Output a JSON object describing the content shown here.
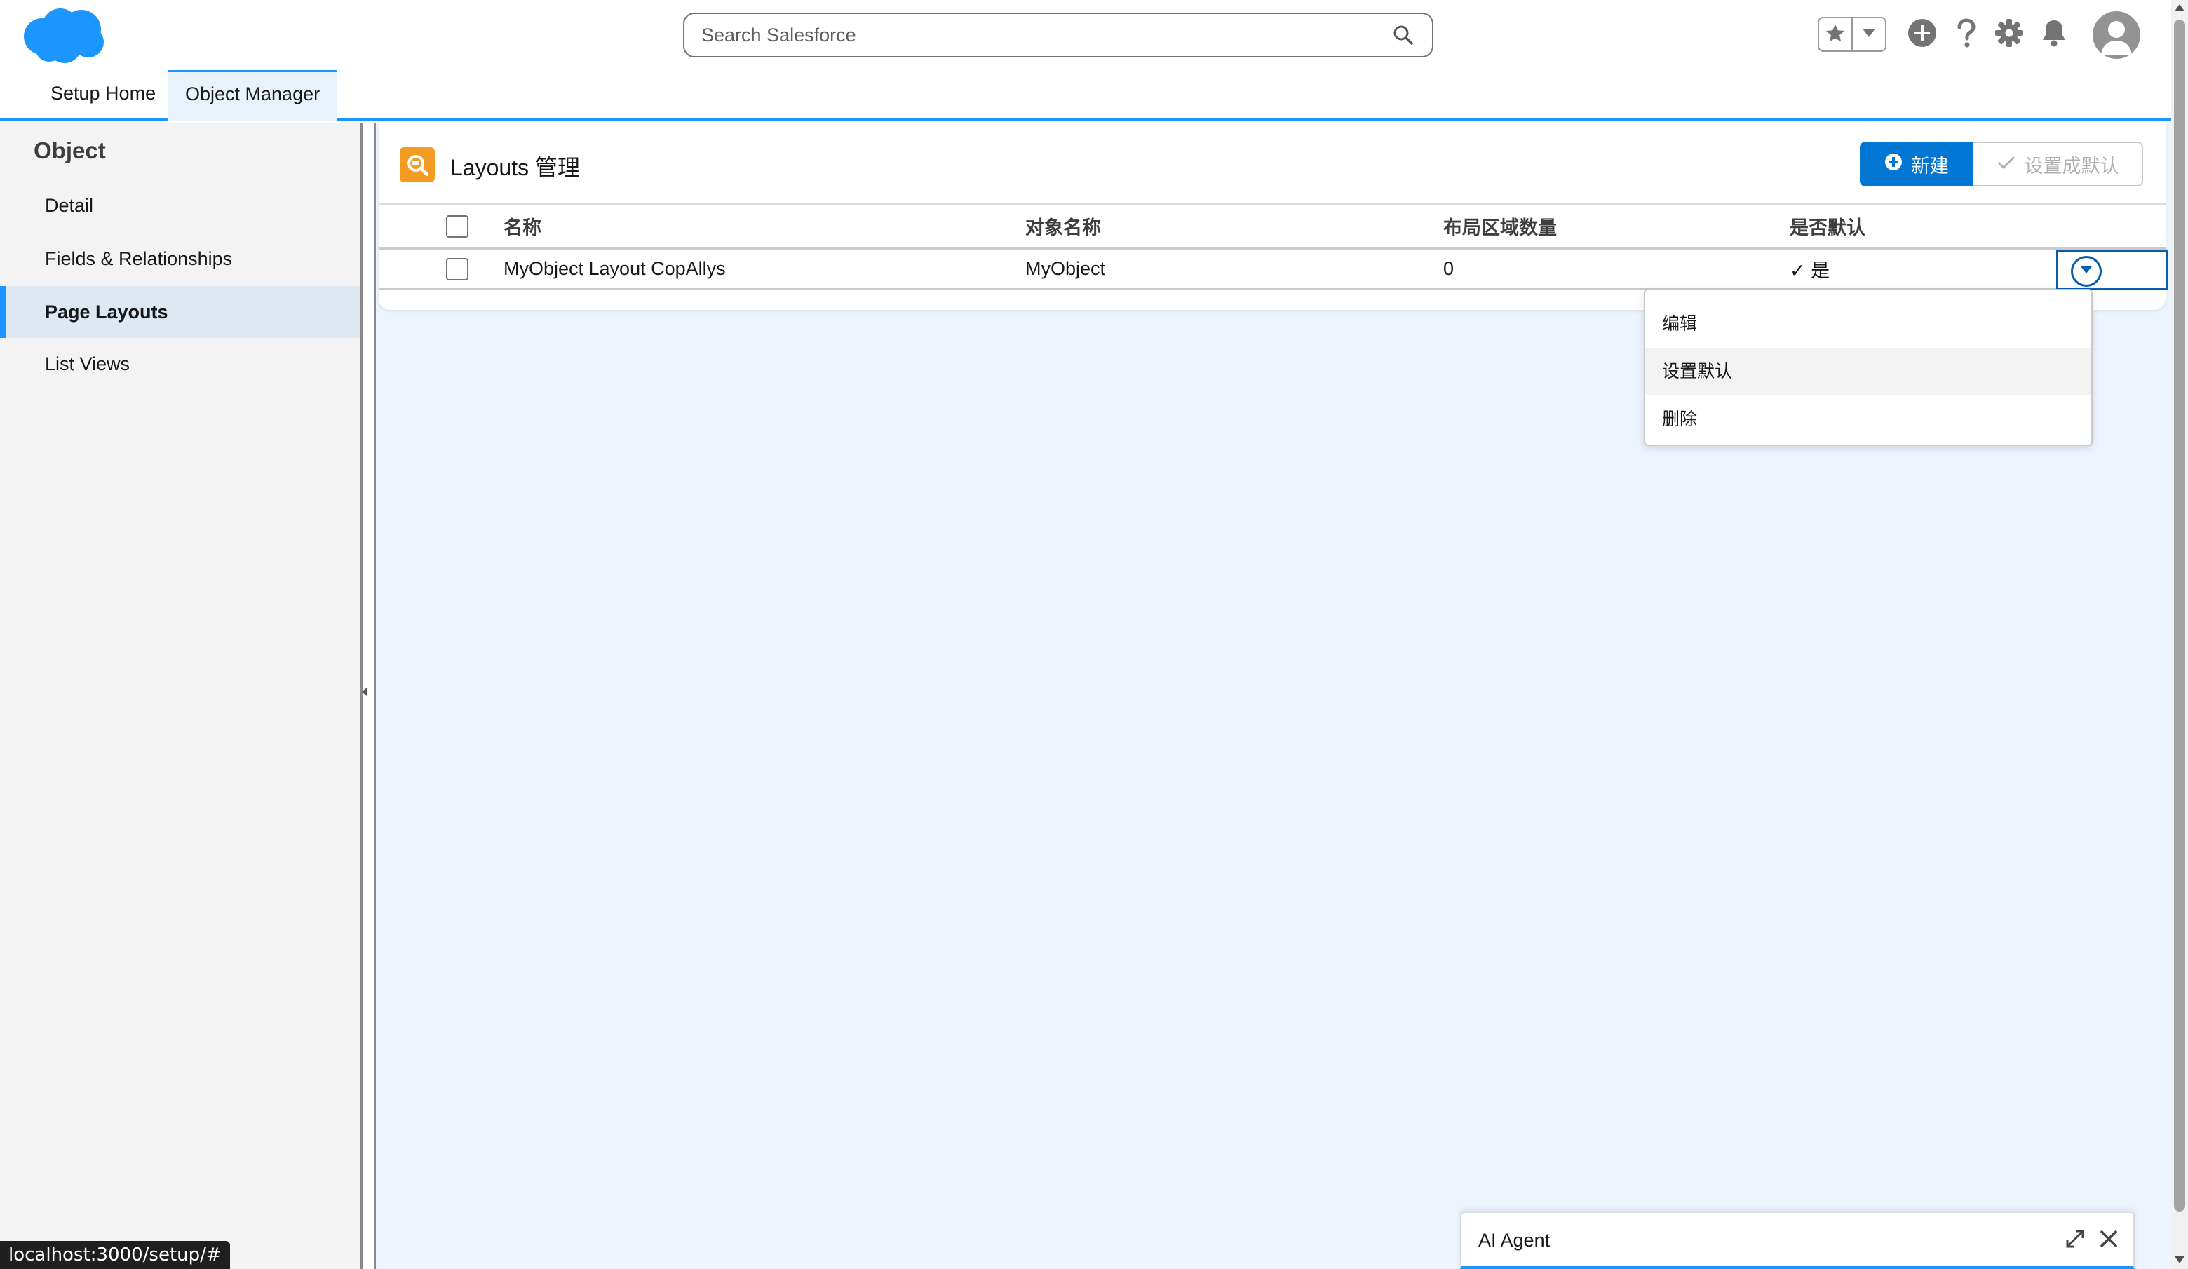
{
  "header": {
    "search_placeholder": "Search Salesforce",
    "brand_color": "#1b96ff",
    "icons": [
      "salesforce-cloud-logo",
      "search-icon",
      "star-icon",
      "chevron-down-icon",
      "plus-circle-icon",
      "help-icon",
      "gear-icon",
      "bell-icon",
      "user-avatar-icon"
    ]
  },
  "tabs": [
    {
      "label": "Setup Home"
    },
    {
      "label": "Object Manager"
    }
  ],
  "sidebar": {
    "title": "Object",
    "items": [
      {
        "label": "Detail"
      },
      {
        "label": "Fields & Relationships"
      },
      {
        "label": "Page Layouts"
      },
      {
        "label": "List Views"
      }
    ]
  },
  "card": {
    "title": "Layouts 管理",
    "new_button": "新建",
    "set_default_button": "设置成默认",
    "columns": [
      "名称",
      "对象名称",
      "布局区域数量",
      "是否默认"
    ],
    "rows": [
      {
        "name": "MyObject Layout CopAllys",
        "object": "MyObject",
        "sections": "0",
        "is_default": "✓ 是"
      }
    ]
  },
  "row_menu": {
    "items": [
      "编辑",
      "设置默认",
      "删除"
    ]
  },
  "ai_agent": {
    "label": "AI Agent"
  },
  "status_bar": {
    "url": "localhost:3000/setup/#"
  }
}
